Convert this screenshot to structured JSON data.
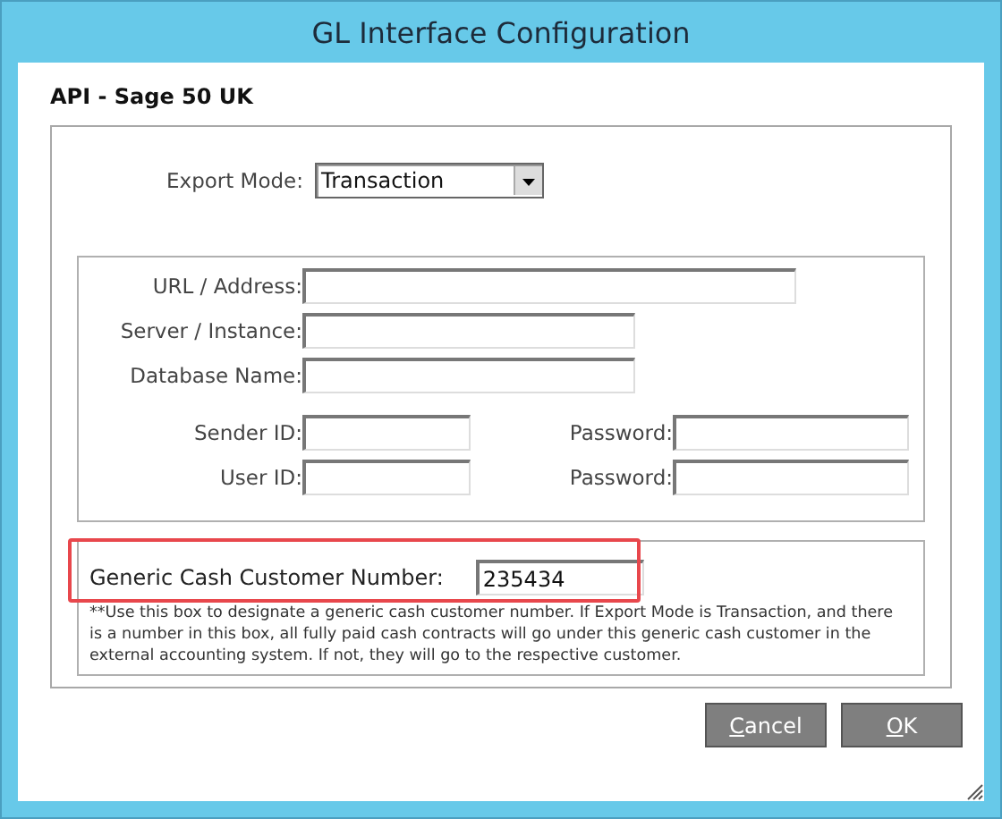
{
  "window": {
    "title": "GL Interface Configuration"
  },
  "section_title": "API - Sage 50 UK",
  "export_mode": {
    "label": "Export Mode:",
    "value": "Transaction"
  },
  "connection_fields": [
    {
      "label": "URL / Address:",
      "kind": "wide"
    },
    {
      "label": "Server / Instance:",
      "kind": "medium"
    },
    {
      "label": "Database Name:",
      "kind": "medium"
    }
  ],
  "credential_rows": [
    {
      "id_label": "Sender ID:",
      "password_label": "Password:"
    },
    {
      "id_label": "User ID:",
      "password_label": "Password:"
    }
  ],
  "generic_cash": {
    "label": "Generic Cash Customer Number:",
    "value": "235434",
    "highlighted": true,
    "note": "**Use this box to designate a generic cash customer number. If Export Mode is Transaction, and there is a number in this box, all fully paid cash contracts will go under this generic cash customer in the external accounting system. If not, they will go to the respective customer."
  },
  "buttons": [
    "Cancel",
    "OK"
  ]
}
